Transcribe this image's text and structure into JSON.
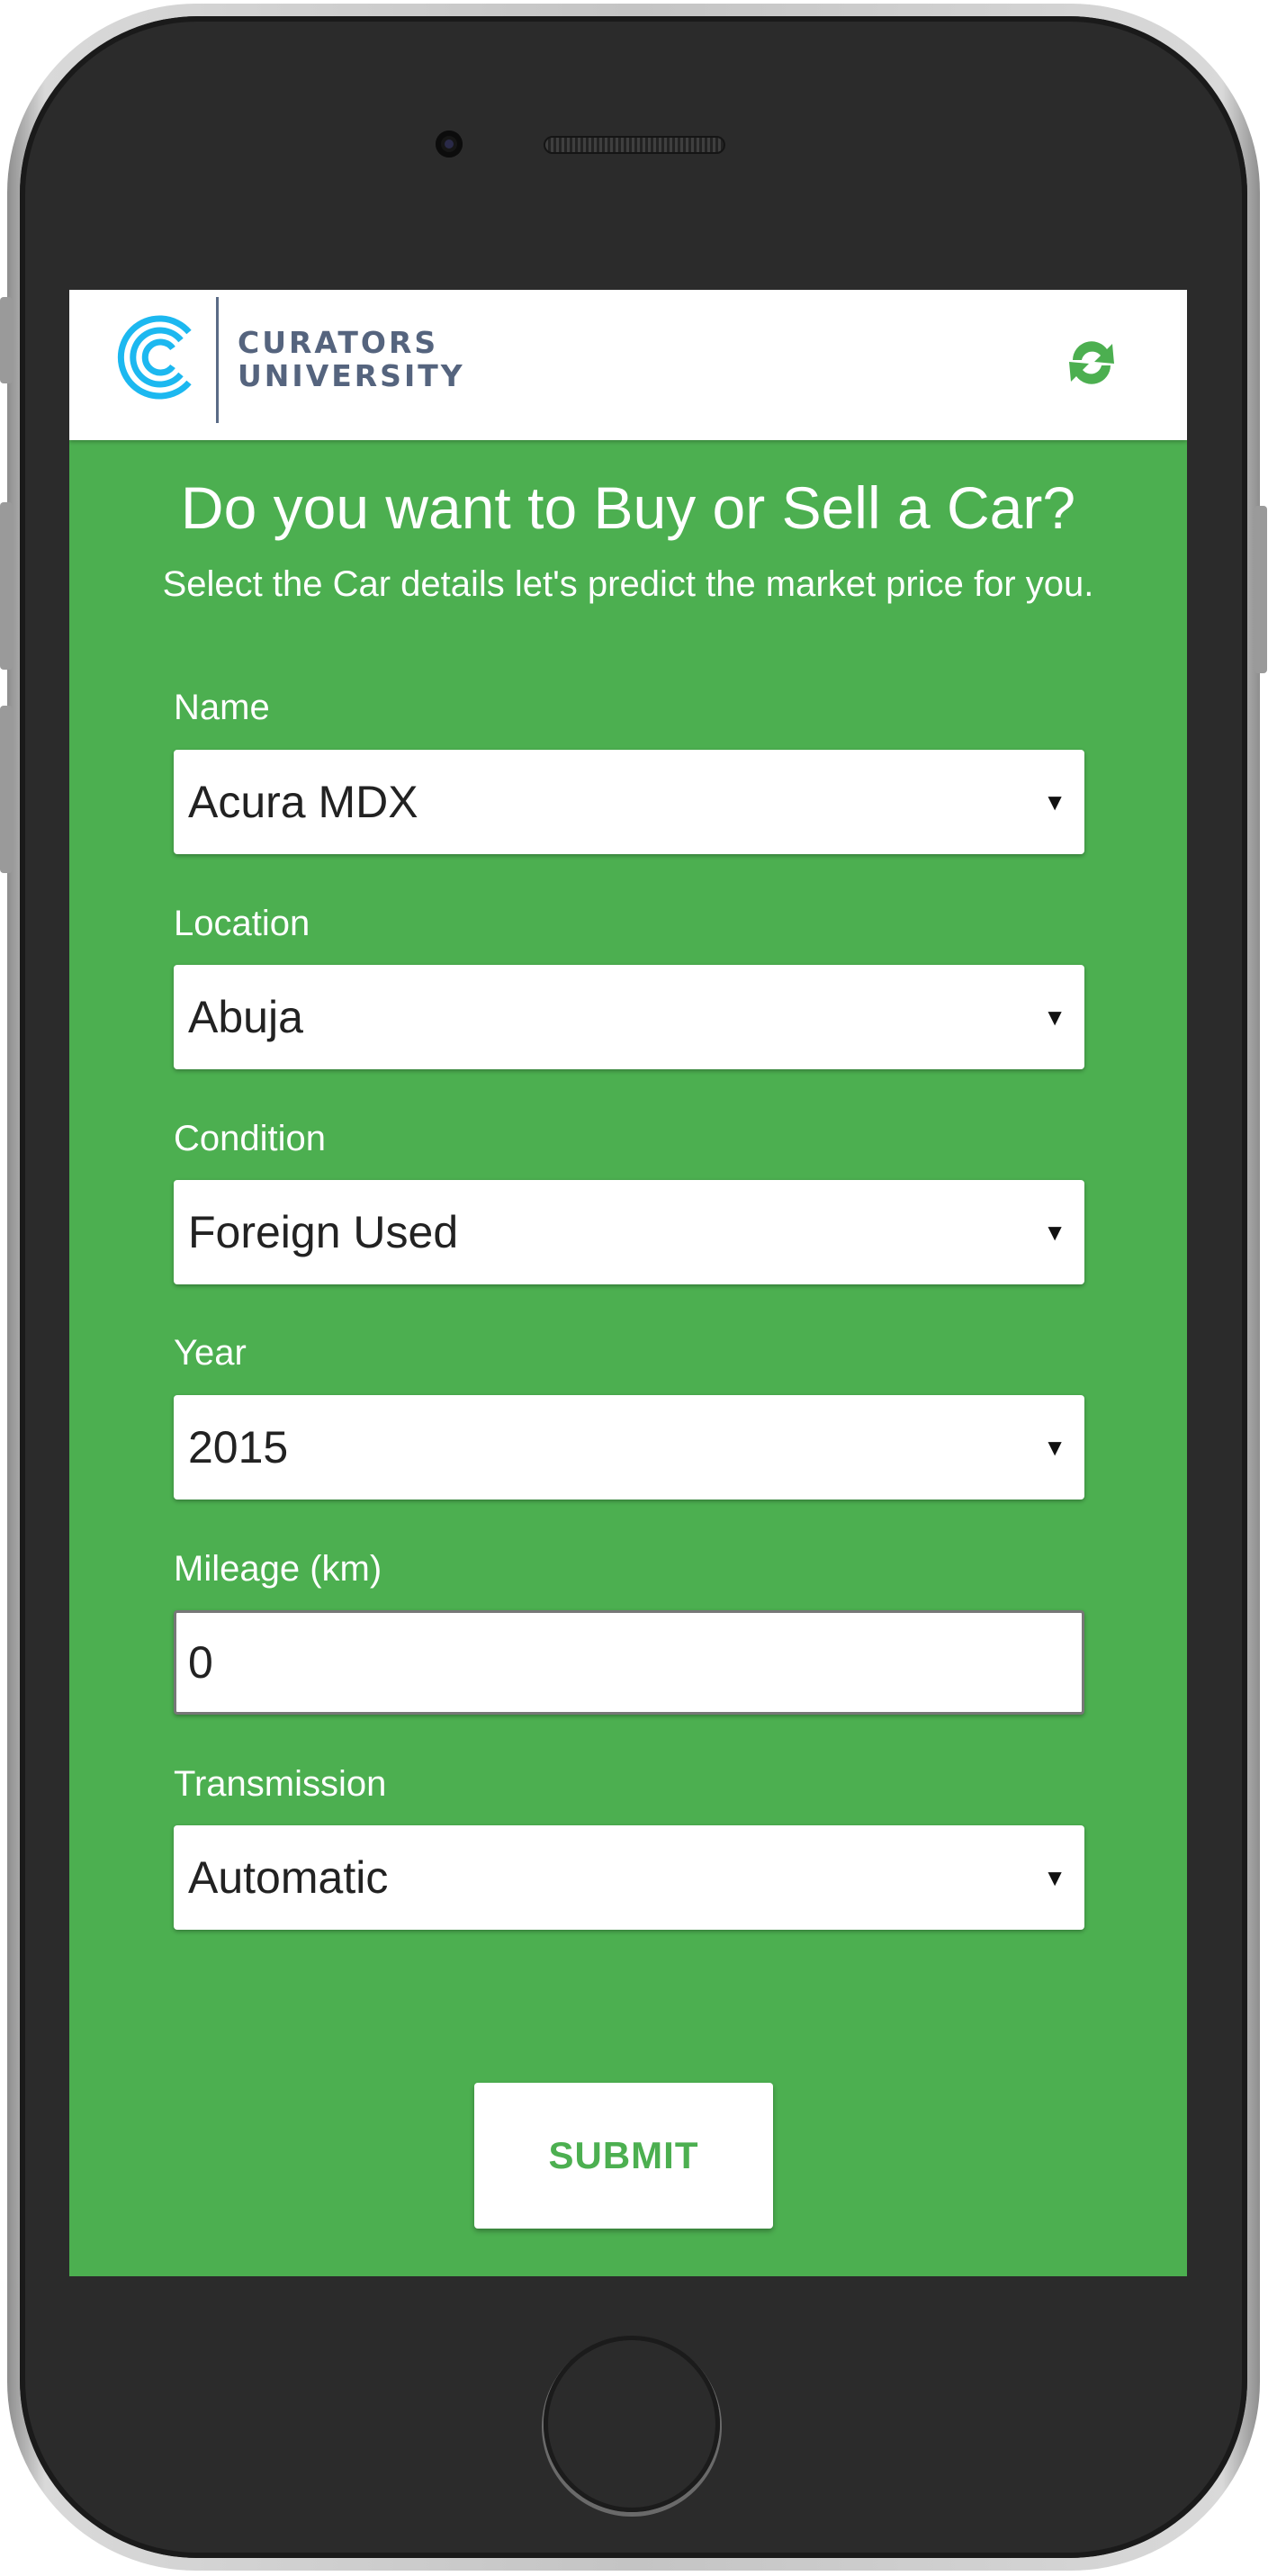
{
  "brand": {
    "name_line1": "CURATORS",
    "name_line2": "UNIVERSITY",
    "logo_color": "#1cb8f0",
    "text_color": "#55647e"
  },
  "header": {
    "refresh_icon": "refresh-icon",
    "refresh_color": "#4caf50"
  },
  "main": {
    "title": "Do you want to Buy or Sell a Car?",
    "subtitle": "Select the Car details let's predict the market price for you."
  },
  "form": {
    "name": {
      "label": "Name",
      "value": "Acura MDX"
    },
    "location": {
      "label": "Location",
      "value": "Abuja"
    },
    "condition": {
      "label": "Condition",
      "value": "Foreign Used"
    },
    "year": {
      "label": "Year",
      "value": "2015"
    },
    "mileage": {
      "label": "Mileage (km)",
      "value": "0"
    },
    "transmission": {
      "label": "Transmission",
      "value": "Automatic"
    },
    "dropdown_arrow": "▼",
    "submit_label": "SUBMIT"
  },
  "theme": {
    "primary_green": "#4caf50",
    "surface": "#ffffff"
  }
}
